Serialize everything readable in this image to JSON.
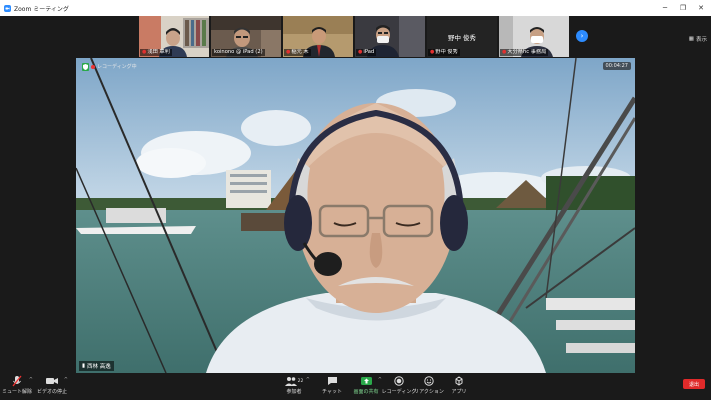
{
  "window": {
    "title": "Zoom ミーティング",
    "controls": [
      "minimize-icon",
      "restore-icon",
      "close-icon"
    ]
  },
  "strip": {
    "view_label": "表示",
    "next_icon": "chevron-right-icon",
    "tiles": [
      {
        "name": "浅田 章利"
      },
      {
        "name": "koinono @ iPad (2)"
      },
      {
        "name": "稲元 木"
      },
      {
        "name": "iPad"
      },
      {
        "name": "野中 俊秀",
        "big_name": "野中 俊秀"
      },
      {
        "name": "大分県hc 事務局"
      }
    ]
  },
  "main": {
    "recording_label": "レコーディング中",
    "elapsed": "00:04:27",
    "speaker_name": "西林 高逸"
  },
  "toolbar": {
    "items": [
      {
        "label": "ミュート解除",
        "icon": "mic-muted-icon"
      },
      {
        "label": "ビデオの停止",
        "icon": "video-camera-icon"
      },
      {
        "label": "参加者",
        "icon": "participants-icon",
        "count": "22"
      },
      {
        "label": "チャット",
        "icon": "chat-icon"
      },
      {
        "label": "画面の共有",
        "icon": "share-screen-icon"
      },
      {
        "label": "レコーディング",
        "icon": "record-icon"
      },
      {
        "label": "リアクション",
        "icon": "reaction-icon"
      },
      {
        "label": "アプリ",
        "icon": "apps-icon"
      }
    ],
    "end_label": "退出"
  },
  "colors": {
    "accent": "#2d8cff",
    "share_green": "#2aa84a",
    "end_red": "#e02a2a",
    "background": "#1a1a1a"
  }
}
